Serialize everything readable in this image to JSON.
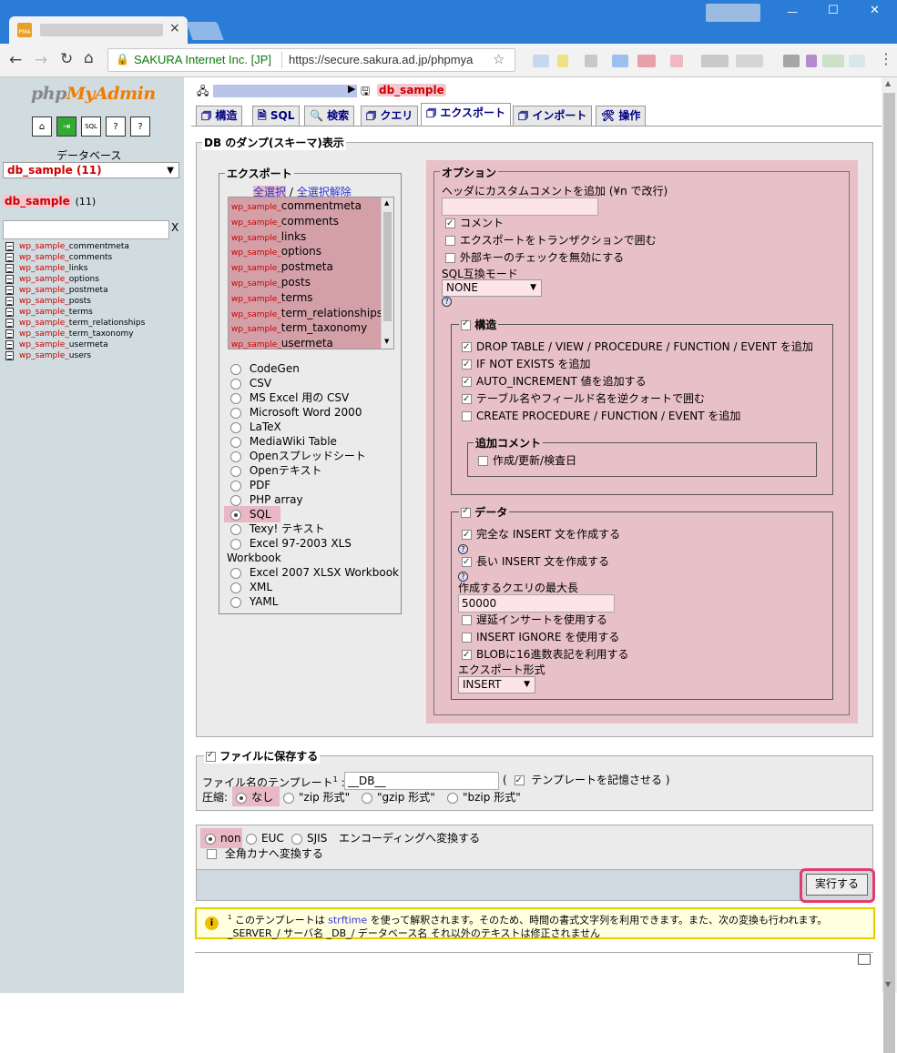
{
  "browser": {
    "omnibox_org": "SAKURA Internet Inc. [JP]",
    "omnibox_url": "https://secure.sakura.ad.jp/phpmya",
    "tab_close": "×",
    "window_controls": [
      "—",
      "☐",
      "✕"
    ]
  },
  "nav": {
    "logo": {
      "php": "php",
      "my": "My",
      "admin": "Admin"
    },
    "database_label": "データベース",
    "db_select_value": "db_sample (11)",
    "db_name": "db_sample",
    "db_count": "(11)",
    "filter_clear": "X",
    "tables": [
      {
        "prefix": "wp_sample_",
        "name": "commentmeta"
      },
      {
        "prefix": "wp_sample_",
        "name": "comments"
      },
      {
        "prefix": "wp_sample_",
        "name": "links"
      },
      {
        "prefix": "wp_sample_",
        "name": "options"
      },
      {
        "prefix": "wp_sample_",
        "name": "postmeta"
      },
      {
        "prefix": "wp_sample_",
        "name": "posts"
      },
      {
        "prefix": "wp_sample_",
        "name": "terms"
      },
      {
        "prefix": "wp_sample_",
        "name": "term_relationships"
      },
      {
        "prefix": "wp_sample_",
        "name": "term_taxonomy"
      },
      {
        "prefix": "wp_sample_",
        "name": "usermeta"
      },
      {
        "prefix": "wp_sample_",
        "name": "users"
      }
    ]
  },
  "breadcrumb": {
    "db": "db_sample"
  },
  "tabs": [
    "構造",
    "SQL",
    "検索",
    "クエリ",
    "エクスポート",
    "インポート",
    "操作"
  ],
  "dump": {
    "legend": "DB のダンプ(スキーマ)表示",
    "export": {
      "legend": "エクスポート",
      "select_all": "全選択",
      "separator": "/",
      "deselect_all": "全選択解除",
      "tables": [
        {
          "prefix": "wp_sample_",
          "name": "commentmeta"
        },
        {
          "prefix": "wp_sample_",
          "name": "comments"
        },
        {
          "prefix": "wp_sample_",
          "name": "links"
        },
        {
          "prefix": "wp_sample_",
          "name": "options"
        },
        {
          "prefix": "wp_sample_",
          "name": "postmeta"
        },
        {
          "prefix": "wp_sample_",
          "name": "posts"
        },
        {
          "prefix": "wp_sample_",
          "name": "terms"
        },
        {
          "prefix": "wp_sample_",
          "name": "term_relationships"
        },
        {
          "prefix": "wp_sample_",
          "name": "term_taxonomy"
        },
        {
          "prefix": "wp_sample_",
          "name": "usermeta"
        }
      ],
      "formats": [
        "CodeGen",
        "CSV",
        "MS Excel 用の CSV",
        "Microsoft Word 2000",
        "LaTeX",
        "MediaWiki Table",
        "Openスプレッドシート",
        "Openテキスト",
        "PDF",
        "PHP array",
        "SQL",
        "Texy! テキスト",
        "Excel 97-2003 XLS",
        "Workbook",
        "Excel 2007 XLSX Workbook",
        "XML",
        "YAML"
      ],
      "selected_format": "SQL"
    },
    "options": {
      "legend": "オプション",
      "header_comment_label": "ヘッダにカスタムコメントを追加 (¥n で改行)",
      "comment": "コメント",
      "transaction": "エクスポートをトランザクションで囲む",
      "disable_fk": "外部キーのチェックを無効にする",
      "compat_label": "SQL互換モード",
      "compat_value": "NONE",
      "help": "?",
      "structure": {
        "legend": "構造",
        "items": [
          {
            "label": "DROP TABLE / VIEW / PROCEDURE / FUNCTION / EVENT を追加",
            "checked": true
          },
          {
            "label": "IF NOT EXISTS を追加",
            "checked": true
          },
          {
            "label": "AUTO_INCREMENT 値を追加する",
            "checked": true
          },
          {
            "label": "テーブル名やフィールド名を逆クォートで囲む",
            "checked": true
          },
          {
            "label": "CREATE PROCEDURE / FUNCTION / EVENT を追加",
            "checked": false
          }
        ],
        "extra_legend": "追加コメント",
        "extra_item": "作成/更新/検査日"
      },
      "data": {
        "legend": "データ",
        "complete_insert": "完全な INSERT 文を作成する",
        "extended_insert": "長い INSERT 文を作成する",
        "max_query_label": "作成するクエリの最大長",
        "max_query_value": "50000",
        "delayed": "遅延インサートを使用する",
        "ignore": "INSERT IGNORE を使用する",
        "hex_blob": "BLOBに16進数表記を利用する",
        "export_type_label": "エクスポート形式",
        "export_type_value": "INSERT"
      }
    }
  },
  "save": {
    "legend": "ファイルに保存する",
    "template_label": "ファイル名のテンプレート",
    "sup": "1",
    "colon": ":",
    "template_value": "__DB__",
    "paren_open": "(",
    "remember": "テンプレートを記憶させる",
    "paren_close": ")",
    "compression_label": "圧縮:",
    "compression": [
      "なし",
      "\"zip 形式\"",
      "\"gzip 形式\"",
      "\"bzip 形式\""
    ]
  },
  "encoding": {
    "options": [
      "non",
      "EUC",
      "SJIS"
    ],
    "suffix": "エンコーディングへ変換する",
    "kana": "全角カナへ変換する"
  },
  "go_button": "実行する",
  "note": {
    "sup": "1",
    "text1": " このテンプレートは ",
    "link": "strftime",
    "text2": " を使って解釈されます。そのため、時間の書式文字列を利用できます。また、次の変換も行われます。_SERVER_/ サーバ名 _DB_/ データベース名 それ以外のテキストは修正されません"
  },
  "colors": {
    "accent_pink": "#e8c0c8",
    "table_sel": "#d4a0a8",
    "nav_bg": "#d0dce0",
    "go_border": "#e23c6b",
    "note_border": "#e0d000"
  }
}
